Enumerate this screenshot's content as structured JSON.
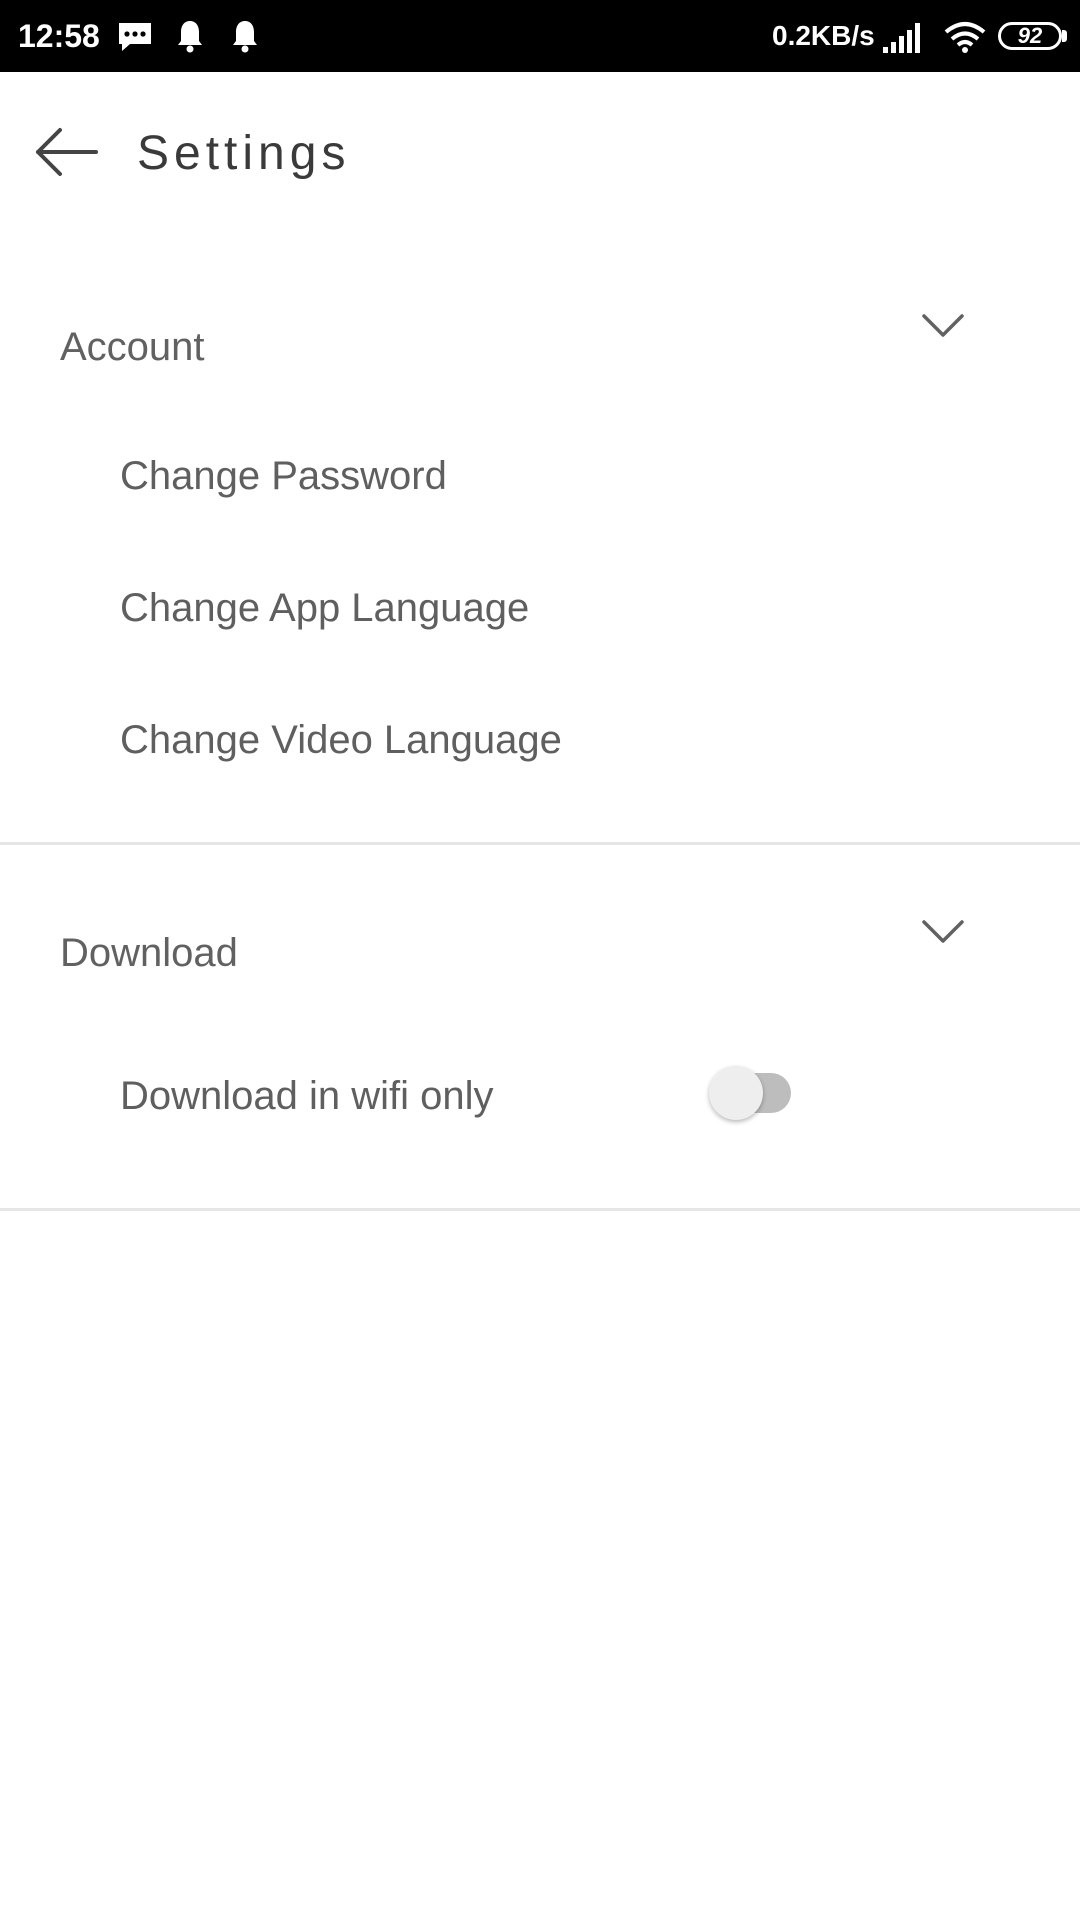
{
  "status_bar": {
    "time": "12:58",
    "network_speed": "0.2KB/s",
    "battery_level": "92",
    "icons": [
      "message-icon",
      "notification-bell-icon",
      "notification-bell-icon",
      "signal-icon",
      "wifi-icon",
      "battery-icon"
    ]
  },
  "app_bar": {
    "title": "Settings",
    "back_icon": "back-arrow-icon"
  },
  "sections": [
    {
      "title": "Account",
      "expand_icon": "chevron-down-icon",
      "items": [
        {
          "label": "Change Password"
        },
        {
          "label": "Change App Language"
        },
        {
          "label": "Change Video Language"
        }
      ]
    },
    {
      "title": "Download",
      "expand_icon": "chevron-down-icon",
      "items": [
        {
          "label": "Download in wifi only",
          "toggle": "off"
        }
      ]
    }
  ],
  "colors": {
    "status_bar_bg": "#000000",
    "background": "#ffffff",
    "title_text": "#3a3a3a",
    "body_text": "#616161",
    "divider": "#e6e6e6",
    "toggle_track_off": "#bdbdbd",
    "toggle_thumb_off": "#eeeeee"
  }
}
